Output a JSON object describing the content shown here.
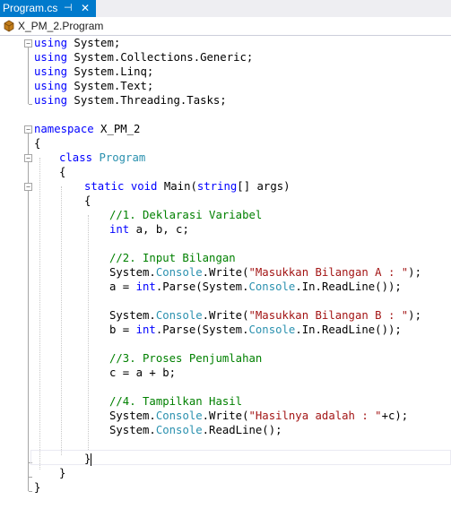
{
  "tab": {
    "filename": "Program.cs",
    "pin_glyph": "⊣",
    "close_glyph": "✕"
  },
  "nav": {
    "icon": "class-icon",
    "breadcrumb": "X_PM_2.Program"
  },
  "code": {
    "l1": [
      "using",
      " System;"
    ],
    "l2": [
      "using",
      " System.Collections.Generic;"
    ],
    "l3": [
      "using",
      " System.Linq;"
    ],
    "l4": [
      "using",
      " System.Text;"
    ],
    "l5": [
      "using",
      " System.Threading.Tasks;"
    ],
    "l7": [
      "namespace",
      " X_PM_2"
    ],
    "l8": "{",
    "l9": [
      "class",
      " ",
      "Program"
    ],
    "l10": "{",
    "l11": [
      "static",
      " ",
      "void",
      " Main(",
      "string",
      "[] args)"
    ],
    "l12": "{",
    "l13": "//1. Deklarasi Variabel",
    "l14": [
      "int",
      " a, b, c;"
    ],
    "l16": "//2. Input Bilangan",
    "l17": [
      "System.",
      "Console",
      ".Write(",
      "\"Masukkan Bilangan A : \"",
      ");"
    ],
    "l18": [
      "a = ",
      "int",
      ".Parse(System.",
      "Console",
      ".In.ReadLine());"
    ],
    "l20": [
      "System.",
      "Console",
      ".Write(",
      "\"Masukkan Bilangan B : \"",
      ");"
    ],
    "l21": [
      "b = ",
      "int",
      ".Parse(System.",
      "Console",
      ".In.ReadLine());"
    ],
    "l23": "//3. Proses Penjumlahan",
    "l24": "c = a + b;",
    "l26": "//4. Tampilkan Hasil",
    "l27": [
      "System.",
      "Console",
      ".Write(",
      "\"Hasilnya adalah : \"",
      "+c);"
    ],
    "l28": [
      "System.",
      "Console",
      ".ReadLine();"
    ],
    "l30": "}",
    "l31": "}",
    "l32": "}"
  }
}
